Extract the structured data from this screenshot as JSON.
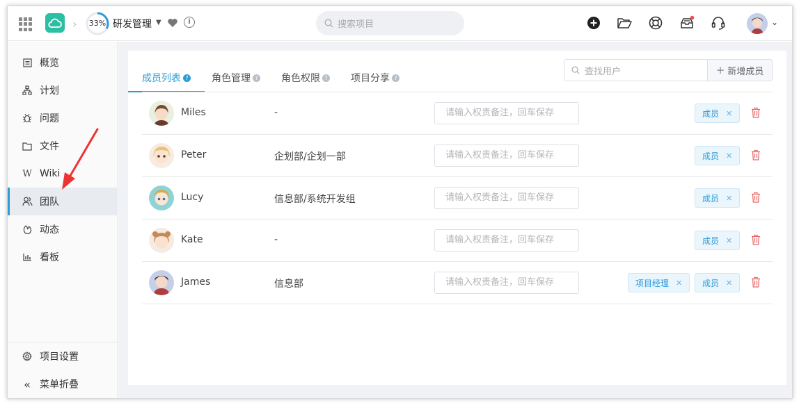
{
  "topbar": {
    "progress_text": "33%",
    "progress_value": 0.33,
    "project_name": "研发管理",
    "search_placeholder": "搜索项目"
  },
  "sidebar": {
    "items": [
      {
        "label": "概览",
        "icon": "overview-icon"
      },
      {
        "label": "计划",
        "icon": "plan-icon"
      },
      {
        "label": "问题",
        "icon": "bug-icon"
      },
      {
        "label": "文件",
        "icon": "folder-icon"
      },
      {
        "label": "Wiki",
        "icon": "wiki-icon"
      },
      {
        "label": "团队",
        "icon": "team-icon"
      },
      {
        "label": "动态",
        "icon": "activity-icon"
      },
      {
        "label": "看板",
        "icon": "chart-icon"
      }
    ],
    "settings_label": "项目设置",
    "collapse_label": "菜单折叠"
  },
  "tabs": [
    "成员列表",
    "角色管理",
    "角色权限",
    "项目分享"
  ],
  "find_user_placeholder": "查找用户",
  "add_member_label": "新增成员",
  "note_placeholder": "请输入权责备注，回车保存",
  "members": [
    {
      "name": "Miles",
      "dept": "-",
      "roles": [
        "成员"
      ]
    },
    {
      "name": "Peter",
      "dept": "企划部/企划一部",
      "roles": [
        "成员"
      ]
    },
    {
      "name": "Lucy",
      "dept": "信息部/系统开发组",
      "roles": [
        "成员"
      ]
    },
    {
      "name": "Kate",
      "dept": "-",
      "roles": [
        "成员"
      ]
    },
    {
      "name": "James",
      "dept": "信息部",
      "roles": [
        "项目经理",
        "成员"
      ]
    }
  ],
  "colors": {
    "accent": "#2e9bd8",
    "logo": "#2bbfa3",
    "danger": "#e86464"
  }
}
